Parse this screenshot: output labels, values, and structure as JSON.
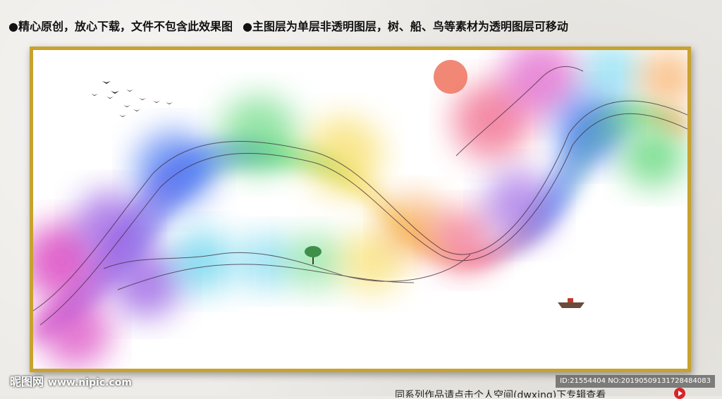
{
  "header": {
    "notice_left": "●精心原创，放心下载，文件不包含此效果图",
    "notice_right": "●主图层为单层非透明图层，树、船、鸟等素材为透明图层可移动"
  },
  "artwork": {
    "colors": {
      "frame": "#c8a22e",
      "sun": "#f07b66",
      "magenta": "#d93fbf",
      "purple": "#8f4fe0",
      "blue": "#3c6ff0",
      "cyan": "#3fc8e8",
      "green": "#4fd36a",
      "yellow": "#f5d640",
      "orange": "#f59a3c",
      "red": "#ec3f6a"
    }
  },
  "footer": {
    "site_logo": "昵图网",
    "site_url": "www.nipic.com",
    "image_id": "ID:21554404 NO:20190509131728484083",
    "more_text": "同系列作品请点击个人空间(dwxing)下专辑查看"
  }
}
